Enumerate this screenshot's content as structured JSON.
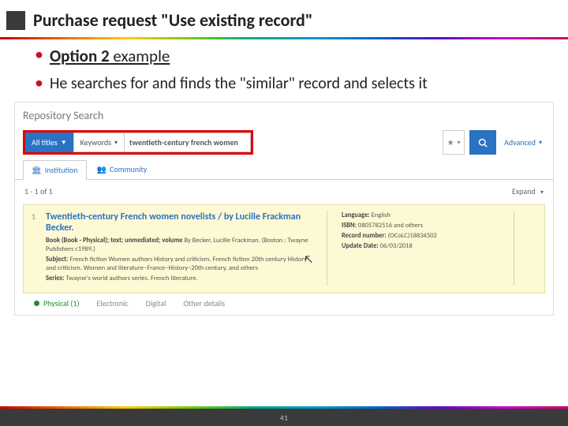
{
  "slide": {
    "title": "Purchase request \"Use existing record\"",
    "bullet1_prefix": "Option 2",
    "bullet1_suffix": " example",
    "bullet2": "He searches for and finds the \"similar\" record and selects it",
    "page_number": "41"
  },
  "screenshot": {
    "repo_title": "Repository Search",
    "dd_scope": "All titles",
    "dd_field": "Keywords",
    "search_value": "twentieth-century french women",
    "star": "★",
    "advanced": "Advanced",
    "tab_institution": "Institution",
    "tab_community": "Community",
    "count": "1 - 1 of 1",
    "expand": "Expand",
    "result": {
      "num": "1",
      "title": "Twentieth-century French women novelists / by Lucille Frackman Becker.",
      "book_label": "Book (Book - Physical); text; unmediated; volume",
      "book_val": " By Becker, Lucille Frackman. (Boston : Twayne Publishers c1989.)",
      "subject_label": "Subject:",
      "subject_val": " French fiction Women authors History and criticism. French fiction 20th century History and criticism. Women and literature–France–History–20th century, and others",
      "series_label": "Series:",
      "series_val": " Twayne's world authors series. French literature.",
      "lang_label": "Language:",
      "lang_val": " English",
      "isbn_label": "ISBN:",
      "isbn_val": " 0805782516 and others",
      "recno_label": "Record number:",
      "recno_val": " (OCoLC)18834502",
      "upd_label": "Update Date:",
      "upd_val": " 06/03/2018"
    },
    "formats": {
      "physical": "Physical (1)",
      "electronic": "Electronic",
      "digital": "Digital",
      "other": "Other details"
    }
  }
}
